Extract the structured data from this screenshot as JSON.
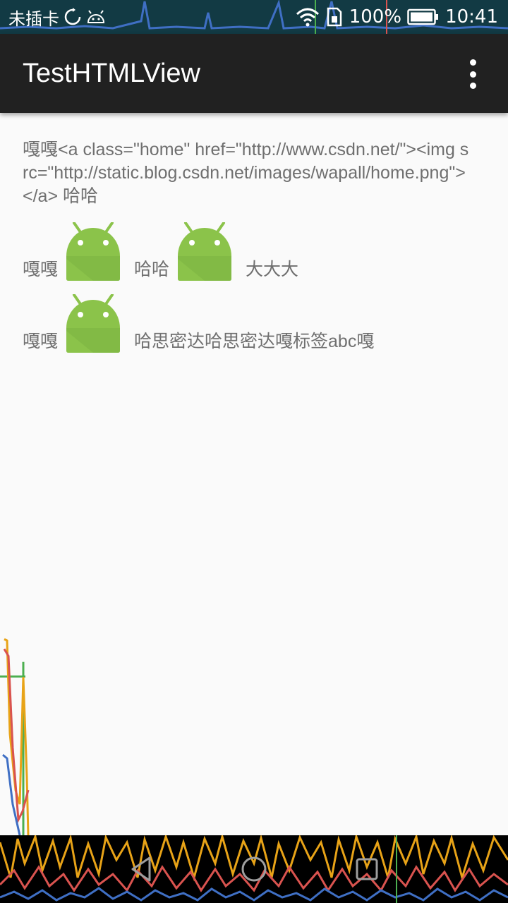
{
  "status_bar": {
    "carrier": "未插卡",
    "icons_left": [
      "sync-icon",
      "android-debug-icon"
    ],
    "icons_right": [
      "wifi-icon",
      "sim-icon"
    ],
    "battery": "100%",
    "time": "10:41"
  },
  "app_bar": {
    "title": "TestHTMLView",
    "overflow_icon": "more-vert-icon"
  },
  "content": {
    "raw_html_line": "嘎嘎<a class=\"home\" href=\"http://www.csdn.net/\"><img src=\"http://static.blog.csdn.net/images/wapall/home.png\"></a> 哈哈",
    "line1": {
      "t1": "嘎嘎",
      "t2": "哈哈",
      "t3": "大大大"
    },
    "line2": {
      "t1": "嘎嘎",
      "t2": "哈思密达哈思密达嘎标签abc嘎"
    },
    "image_icon": "android-robot-icon"
  },
  "nav_bar": {
    "buttons": [
      "back-icon",
      "home-icon",
      "recents-icon"
    ]
  },
  "colors": {
    "app_bar": "#212121",
    "status_bar": "#123a44",
    "text": "#6f6f6f",
    "android_green": "#8bc34a",
    "background": "#fafafa"
  }
}
